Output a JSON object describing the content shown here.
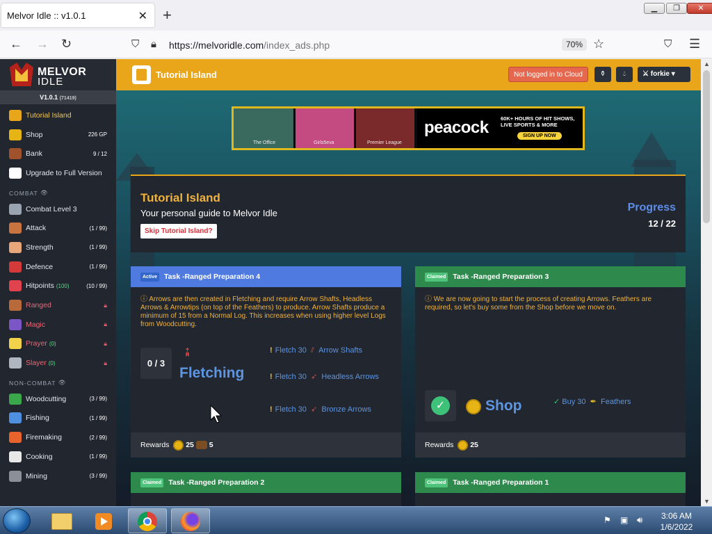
{
  "browser": {
    "tab_title": "Melvor Idle :: v1.0.1",
    "url_domain": "https://melvoridle.com",
    "url_path": "/index_ads.php",
    "zoom": "70%"
  },
  "sidebar": {
    "logo_top": "MELVOR",
    "logo_bottom": "IDLE",
    "version": "V1.0.1",
    "build": "(71419)",
    "top": [
      {
        "label": "Tutorial Island",
        "right": "",
        "color": "#e9a61a"
      },
      {
        "label": "Shop",
        "right": "226 GP",
        "color": "#e7b416"
      },
      {
        "label": "Bank",
        "right": "9 / 12",
        "color": "#a0522d"
      },
      {
        "label": "Upgrade to Full Version",
        "right": "",
        "color": "#ffffff"
      }
    ],
    "combat_head": "COMBAT",
    "combat": [
      {
        "label": "Combat Level 3",
        "right": "",
        "color": "#9aa3b0"
      },
      {
        "label": "Attack",
        "right": "(1 / 99)",
        "color": "#c9733f"
      },
      {
        "label": "Strength",
        "right": "(1 / 99)",
        "color": "#e7a77a"
      },
      {
        "label": "Defence",
        "right": "(1 / 99)",
        "color": "#d43a3a"
      },
      {
        "label": "Hitpoints",
        "extra": "(100)",
        "right": "(10 / 99)",
        "color": "#e0424e"
      },
      {
        "label": "Ranged",
        "right": "locked",
        "color": "#b86a3a"
      },
      {
        "label": "Magic",
        "right": "locked",
        "color": "#7b56c6"
      },
      {
        "label": "Prayer",
        "extra": "(0)",
        "right": "locked",
        "color": "#f2d24a"
      },
      {
        "label": "Slayer",
        "extra": "(0)",
        "right": "locked",
        "color": "#b0b6c0"
      }
    ],
    "noncombat_head": "NON-COMBAT",
    "noncombat": [
      {
        "label": "Woodcutting",
        "right": "(3 / 99)",
        "color": "#3aa84a"
      },
      {
        "label": "Fishing",
        "right": "(1 / 99)",
        "color": "#4f8fe0"
      },
      {
        "label": "Firemaking",
        "right": "(2 / 99)",
        "color": "#e8632c"
      },
      {
        "label": "Cooking",
        "right": "(1 / 99)",
        "color": "#e8e8e8"
      },
      {
        "label": "Mining",
        "right": "(3 / 99)",
        "color": "#8a8f98"
      }
    ]
  },
  "header": {
    "title": "Tutorial Island",
    "cloud": "Not logged in to Cloud",
    "user": "forkie"
  },
  "ad": {
    "img1": "The Office",
    "img2": "Girls5eva",
    "img3": "Premier League",
    "brand": "peacock",
    "line1": "60K+ HOURS OF HIT SHOWS,",
    "line2": "LIVE SPORTS & MORE",
    "cta": "SIGN UP NOW"
  },
  "tutorial": {
    "title": "Tutorial Island",
    "subtitle": "Your personal guide to Melvor Idle",
    "skip": "Skip Tutorial Island?",
    "progress_label": "Progress",
    "progress": "12 / 22"
  },
  "tasks": [
    {
      "badge": "Active",
      "title": "Task -Ranged Preparation 4",
      "desc": "Arrows are then created in Fletching and require Arrow Shafts, Headless Arrows & Arrowtips (on top of the Feathers) to produce. Arrow Shafts produce a minimum of 15 from a Normal Log. This increases when using higher level Logs from Woodcutting.",
      "count": "0 / 3",
      "skill": "Fletching",
      "req": [
        {
          "action": "Fletch 30",
          "item": "Arrow Shafts"
        },
        {
          "action": "Fletch 30",
          "item": "Headless Arrows"
        },
        {
          "action": "Fletch 30",
          "item": "Bronze Arrows"
        }
      ],
      "rewards_label": "Rewards",
      "gp": "25",
      "logs": "5"
    },
    {
      "badge": "Claimed",
      "title": "Task -Ranged Preparation 3",
      "desc": "We are now going to start the process of creating Arrows. Feathers are required, so let's buy some from the Shop before we move on.",
      "skill": "Shop",
      "req": [
        {
          "action": "Buy 30",
          "item": "Feathers"
        }
      ],
      "rewards_label": "Rewards",
      "gp": "25"
    },
    {
      "badge": "Claimed",
      "title": "Task -Ranged Preparation 2"
    },
    {
      "badge": "Claimed",
      "title": "Task -Ranged Preparation 1"
    }
  ],
  "taskbar": {
    "time": "3:06 AM",
    "date": "1/6/2022"
  }
}
